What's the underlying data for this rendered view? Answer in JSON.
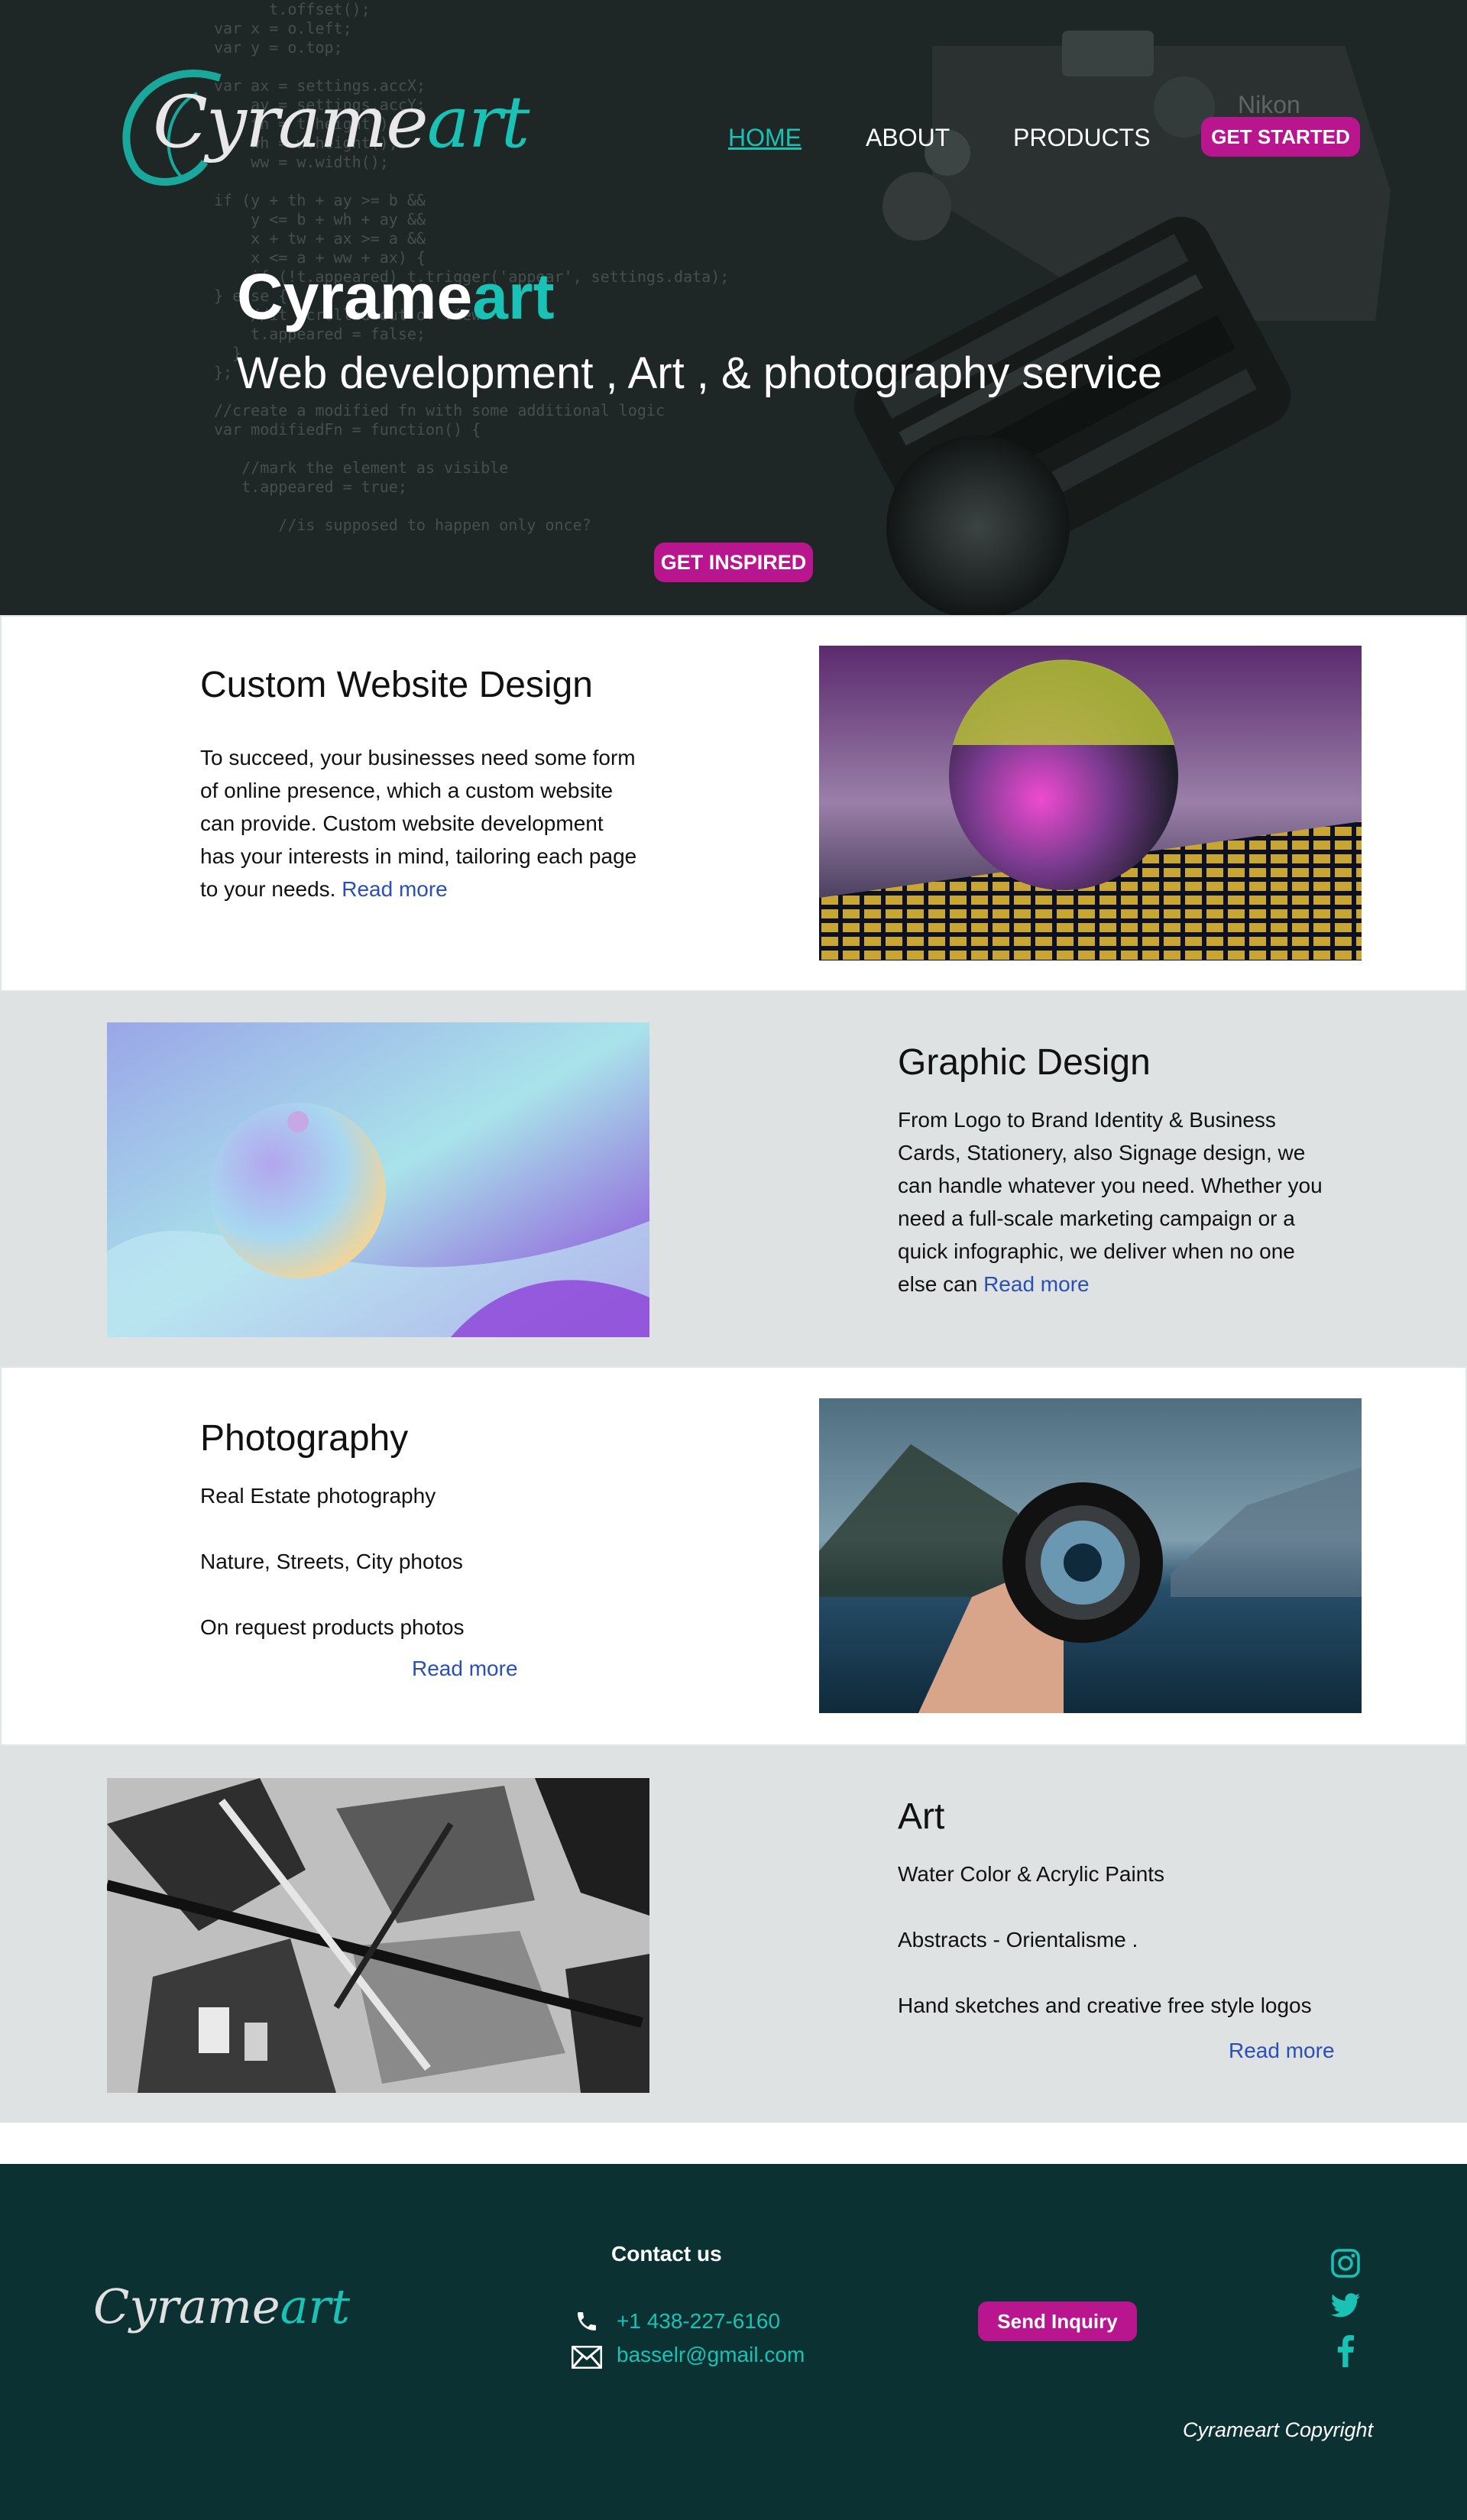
{
  "brand": {
    "logo_main": "Cyrame",
    "logo_accent": "art"
  },
  "nav": {
    "home": "HOME",
    "about": "ABOUT",
    "products": "PRODUCTS",
    "get_started": "GET STARTED"
  },
  "hero": {
    "title_main": "Cyrame",
    "title_accent": "art",
    "subtitle": "Web development , Art , & photography service",
    "cta": "GET INSPIRED"
  },
  "sections": {
    "web": {
      "title": "Custom Website Design",
      "body": "To succeed, your businesses need some form of online presence, which a custom website can provide. Custom website development has your interests in mind, tailoring each page to your needs.",
      "read_more": "Read more"
    },
    "graphic": {
      "title": "Graphic Design",
      "body": "From Logo to  Brand Identity & Business Cards, Stationery, also  Signage design, we can handle whatever you need. Whether you need a full-scale marketing campaign or a quick infographic, we deliver when no one else can",
      "read_more": "Read more"
    },
    "photo": {
      "title": "Photography",
      "items": [
        "Real Estate photography",
        "Nature, Streets, City photos",
        "On request products photos"
      ],
      "read_more": "Read more"
    },
    "art": {
      "title": "Art",
      "items": [
        "Water Color & Acrylic Paints",
        "Abstracts - Orientalisme  .",
        "Hand sketches and creative free style logos"
      ],
      "read_more": "Read more"
    }
  },
  "footer": {
    "contact_title": "Contact us",
    "phone": "+1 438-227-6160",
    "email": "basselr@gmail.com",
    "send_inquiry": "Send Inquiry",
    "copyright": "Cyrameart Copyright",
    "social_icons": [
      "instagram-icon",
      "twitter-icon",
      "facebook-icon"
    ]
  },
  "colors": {
    "accent": "#19c2b4",
    "pink": "#b9158e",
    "hero_bg": "#1f2726",
    "footer_bg": "#0b3133",
    "section_gray": "#dfe2e3",
    "link_blue": "#2a4fb5"
  }
}
